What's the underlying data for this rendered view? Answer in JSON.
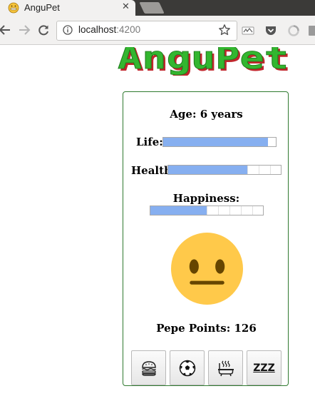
{
  "browser": {
    "tab_title": "AnguPet",
    "tab_close": "✕",
    "url_host": "localhost",
    "url_port": ":4200"
  },
  "logo": "AnguPet",
  "pet": {
    "age_text": "Age: 6 years",
    "life_label": "Life:",
    "life_level": 0.93,
    "health_label": "Health:",
    "health_level": 0.7,
    "happiness_label": "Happiness:",
    "happiness_level": 0.5,
    "mood_icon": "neutral-face",
    "points_text": "Pepe Points: 126"
  },
  "actions": [
    {
      "icon": "burger-icon",
      "zzz": ""
    },
    {
      "icon": "soccer-ball-icon",
      "zzz": ""
    },
    {
      "icon": "bathtub-icon",
      "zzz": ""
    },
    {
      "icon": "sleep-icon",
      "zzz": "ZZZ"
    }
  ],
  "colors": {
    "bar_fill": "#86aff0",
    "card_border": "#2f7a2f",
    "logo_green": "#33b62f",
    "logo_red": "#c0262c",
    "face": "#ffc94a"
  }
}
